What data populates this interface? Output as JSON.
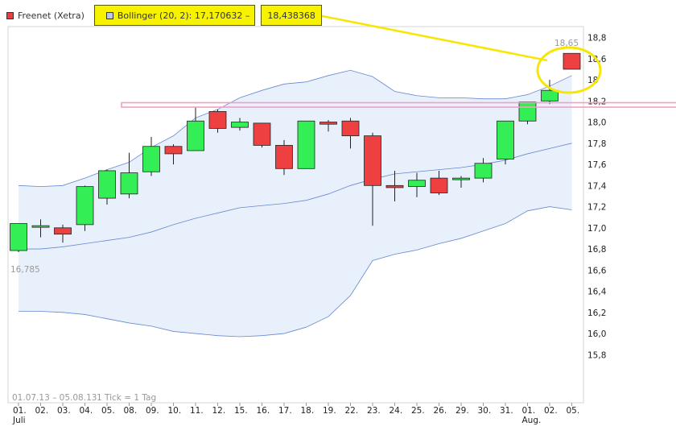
{
  "legend": {
    "main_label": "Freenet (Xetra)",
    "main_swatch_color": "#e84040",
    "bollinger_prefix": "Bollinger (20, 2): 17,170632 –",
    "bollinger_upper": "18,438368",
    "bollinger_swatch_color": "#b8c8e8",
    "highlight_color": "#f7f200"
  },
  "footer": {
    "range_text": "01.07.13 – 05.08.13",
    "tick_text": "1 Tick = 1 Tag"
  },
  "chart_data": {
    "type": "candlestick",
    "ylim": [
      15.65,
      18.85
    ],
    "y_ticks": [
      {
        "v": 18.8,
        "label": "18,8"
      },
      {
        "v": 18.6,
        "label": "18,6"
      },
      {
        "v": 18.4,
        "label": "18"
      },
      {
        "v": 18.2,
        "label": "18,2"
      },
      {
        "v": 18.0,
        "label": "18,0"
      },
      {
        "v": 17.8,
        "label": "17,8"
      },
      {
        "v": 17.6,
        "label": "17,6"
      },
      {
        "v": 17.4,
        "label": "17,4"
      },
      {
        "v": 17.2,
        "label": "17,2"
      },
      {
        "v": 17.0,
        "label": "17,0"
      },
      {
        "v": 16.8,
        "label": "16,8"
      },
      {
        "v": 16.6,
        "label": "16,6"
      },
      {
        "v": 16.4,
        "label": "16,4"
      },
      {
        "v": 16.2,
        "label": "16,2"
      },
      {
        "v": 16.0,
        "label": "16,0"
      },
      {
        "v": 15.8,
        "label": "15,8"
      }
    ],
    "x_labels": [
      "01.",
      "02.",
      "03.",
      "04.",
      "05.",
      "08.",
      "09.",
      "10.",
      "11.",
      "12.",
      "15.",
      "16.",
      "17.",
      "18.",
      "19.",
      "22.",
      "23.",
      "24.",
      "25.",
      "26.",
      "29.",
      "30.",
      "31.",
      "01.",
      "02.",
      "05."
    ],
    "x_sublabels": {
      "0": "Juli",
      "23": "Aug."
    },
    "candles": [
      {
        "o": 16.785,
        "h": 17.04,
        "l": 16.77,
        "c": 17.04
      },
      {
        "o": 17.01,
        "h": 17.08,
        "l": 16.91,
        "c": 17.02
      },
      {
        "o": 17.0,
        "h": 17.03,
        "l": 16.86,
        "c": 16.94
      },
      {
        "o": 17.03,
        "h": 17.4,
        "l": 16.97,
        "c": 17.39
      },
      {
        "o": 17.28,
        "h": 17.55,
        "l": 17.22,
        "c": 17.54
      },
      {
        "o": 17.32,
        "h": 17.71,
        "l": 17.28,
        "c": 17.52
      },
      {
        "o": 17.53,
        "h": 17.86,
        "l": 17.49,
        "c": 17.77
      },
      {
        "o": 17.77,
        "h": 17.79,
        "l": 17.6,
        "c": 17.7
      },
      {
        "o": 17.73,
        "h": 18.14,
        "l": 17.73,
        "c": 18.01
      },
      {
        "o": 18.1,
        "h": 18.12,
        "l": 17.9,
        "c": 17.94
      },
      {
        "o": 17.95,
        "h": 18.04,
        "l": 17.92,
        "c": 18.0
      },
      {
        "o": 17.99,
        "h": 17.99,
        "l": 17.76,
        "c": 17.78
      },
      {
        "o": 17.78,
        "h": 17.83,
        "l": 17.5,
        "c": 17.56
      },
      {
        "o": 17.56,
        "h": 18.01,
        "l": 17.56,
        "c": 18.01
      },
      {
        "o": 18.0,
        "h": 18.02,
        "l": 17.91,
        "c": 17.98
      },
      {
        "o": 18.01,
        "h": 18.04,
        "l": 17.75,
        "c": 17.87
      },
      {
        "o": 17.87,
        "h": 17.9,
        "l": 17.02,
        "c": 17.4
      },
      {
        "o": 17.4,
        "h": 17.54,
        "l": 17.25,
        "c": 17.38
      },
      {
        "o": 17.39,
        "h": 17.52,
        "l": 17.29,
        "c": 17.45
      },
      {
        "o": 17.47,
        "h": 17.54,
        "l": 17.31,
        "c": 17.33
      },
      {
        "o": 17.47,
        "h": 17.49,
        "l": 17.38,
        "c": 17.47
      },
      {
        "o": 17.47,
        "h": 17.66,
        "l": 17.43,
        "c": 17.61
      },
      {
        "o": 17.65,
        "h": 18.01,
        "l": 17.6,
        "c": 18.01
      },
      {
        "o": 18.01,
        "h": 18.18,
        "l": 17.98,
        "c": 18.19
      },
      {
        "o": 18.2,
        "h": 18.4,
        "l": 18.17,
        "c": 18.3
      },
      {
        "o": 18.65,
        "h": 18.65,
        "l": 18.5,
        "c": 18.5
      }
    ],
    "bollinger": {
      "upper": [
        17.4,
        17.39,
        17.4,
        17.47,
        17.55,
        17.62,
        17.76,
        17.87,
        18.04,
        18.12,
        18.23,
        18.3,
        18.36,
        18.38,
        18.44,
        18.49,
        18.43,
        18.29,
        18.25,
        18.23,
        18.23,
        18.22,
        18.22,
        18.26,
        18.34,
        18.44
      ],
      "middle": [
        16.8,
        16.8,
        16.82,
        16.85,
        16.88,
        16.91,
        16.96,
        17.03,
        17.09,
        17.14,
        17.19,
        17.21,
        17.23,
        17.26,
        17.32,
        17.4,
        17.46,
        17.51,
        17.53,
        17.55,
        17.57,
        17.6,
        17.64,
        17.7,
        17.75,
        17.8
      ],
      "lower": [
        16.21,
        16.21,
        16.2,
        16.18,
        16.14,
        16.1,
        16.07,
        16.02,
        16.0,
        15.98,
        15.97,
        15.98,
        16.0,
        16.06,
        16.16,
        16.36,
        16.69,
        16.75,
        16.79,
        16.85,
        16.9,
        16.97,
        17.04,
        17.16,
        17.2,
        17.17
      ]
    },
    "annotations": {
      "max_label": "18,65",
      "min_label": "16,785"
    },
    "colors": {
      "up": "#33ee55",
      "down": "#ee4040",
      "band_fill": "#e8f0fc",
      "band_line": "#6688d0",
      "highlight_line": "#f7e600",
      "pink_rect": "#f0a0c0"
    }
  }
}
